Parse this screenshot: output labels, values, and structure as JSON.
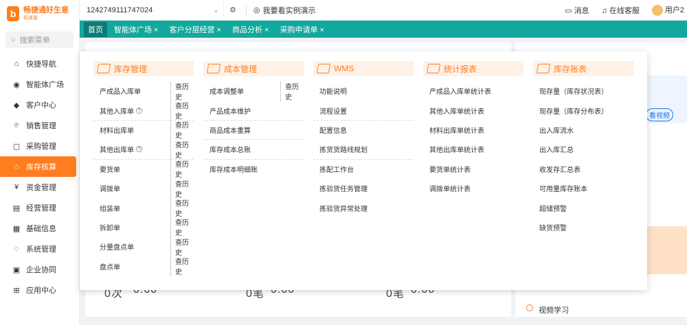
{
  "app": {
    "brand": "畅捷通好生意",
    "brand_sub": "标准版"
  },
  "sidebar": {
    "search_placeholder": "搜索菜单",
    "items": [
      {
        "label": "快捷导航",
        "icon": "home-icon"
      },
      {
        "label": "智能体广场",
        "icon": "ai-icon"
      },
      {
        "label": "客户中心",
        "icon": "diamond-icon"
      },
      {
        "label": "销售管理",
        "icon": "sales-icon"
      },
      {
        "label": "采购管理",
        "icon": "bag-icon"
      },
      {
        "label": "库存核算",
        "icon": "warehouse-icon",
        "active": true
      },
      {
        "label": "资金管理",
        "icon": "money-icon"
      },
      {
        "label": "经营管理",
        "icon": "clipboard-icon"
      },
      {
        "label": "基础信息",
        "icon": "info-icon"
      },
      {
        "label": "系统管理",
        "icon": "system-icon"
      },
      {
        "label": "企业协同",
        "icon": "collab-icon"
      },
      {
        "label": "应用中心",
        "icon": "app-icon"
      }
    ]
  },
  "topbar": {
    "account": "1242749111747024",
    "demo_label": "我要看实例演示",
    "messages": "消息",
    "support": "在线客服",
    "user": "用户2"
  },
  "tabs": [
    "首页",
    "智能体广场",
    "客户分层经营",
    "商品分析",
    "采购申请单"
  ],
  "background": {
    "video_link": "看视频",
    "video_study": "视频学习",
    "stats": [
      "0次",
      "0.00",
      "0笔",
      "0.00",
      "0笔",
      "0.00"
    ]
  },
  "dropdown": {
    "history_label": "查历史",
    "columns": [
      {
        "title": "库存管理",
        "rows": [
          {
            "label": "产成品入库单",
            "history": true
          },
          {
            "label": "其他入库单",
            "history": true,
            "help": true
          },
          {
            "label": "材料出库单",
            "history": true
          },
          {
            "label": "其他出库单",
            "history": true,
            "help": true
          },
          {
            "label": "要货单",
            "history": true
          },
          {
            "label": "调拨单",
            "history": true
          },
          {
            "label": "组装单",
            "history": true
          },
          {
            "label": "拆卸单",
            "history": true
          },
          {
            "label": "分量盘点单",
            "history": true
          },
          {
            "label": "盘点单",
            "history": true
          }
        ]
      },
      {
        "title": "成本管理",
        "rows": [
          {
            "label": "成本调整单",
            "history": true
          },
          {
            "label": "产品成本维护"
          },
          {
            "label": "商品成本重算"
          },
          {
            "label": "库存成本总账"
          },
          {
            "label": "库存成本明细账"
          }
        ]
      },
      {
        "title": "WMS",
        "rows": [
          {
            "label": "功能说明"
          },
          {
            "label": "流程设置"
          },
          {
            "label": "配置信息"
          },
          {
            "label": "拣货货路线规划"
          },
          {
            "label": "拣配工作台"
          },
          {
            "label": "拣验货任务管理"
          },
          {
            "label": "拣验货异常处理"
          }
        ]
      },
      {
        "title": "统计报表",
        "rows": [
          {
            "label": "产成品入库单统计表"
          },
          {
            "label": "其他入库单统计表"
          },
          {
            "label": "材料出库单统计表"
          },
          {
            "label": "其他出库单统计表"
          },
          {
            "label": "要货单统计表"
          },
          {
            "label": "调拨单统计表"
          }
        ]
      },
      {
        "title": "库存账表",
        "rows": [
          {
            "label": "现存量（库存状况表）"
          },
          {
            "label": "现存量（库存分布表）"
          },
          {
            "label": "出入库流水"
          },
          {
            "label": "出入库汇总"
          },
          {
            "label": "收发存汇总表"
          },
          {
            "label": "可用量库存账本"
          },
          {
            "label": "超储预警"
          },
          {
            "label": "缺货预警"
          }
        ]
      }
    ]
  }
}
